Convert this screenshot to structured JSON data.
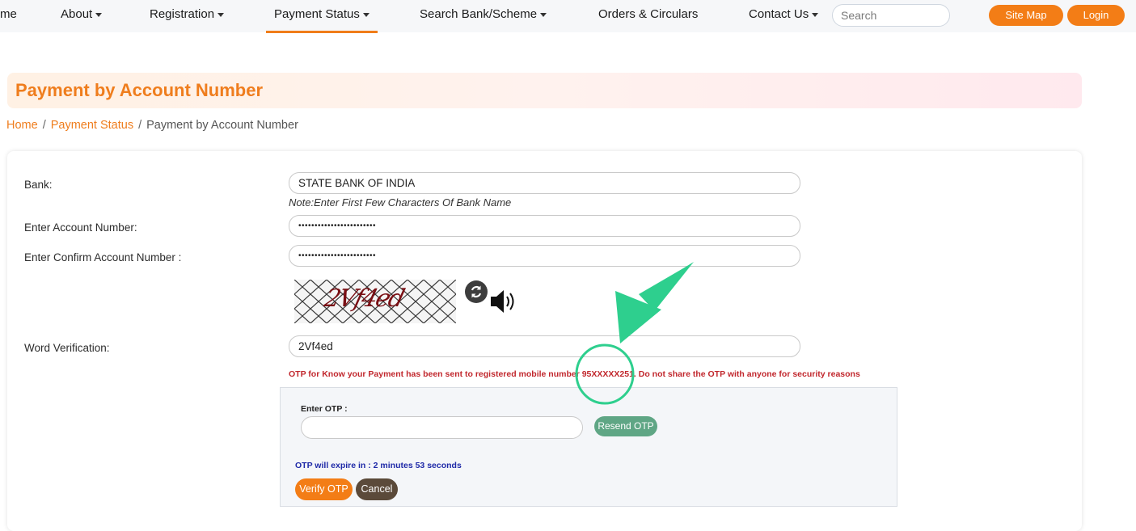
{
  "nav": {
    "items": [
      {
        "label": "me",
        "dropdown": false
      },
      {
        "label": "About",
        "dropdown": true
      },
      {
        "label": "Registration",
        "dropdown": true
      },
      {
        "label": "Payment Status",
        "dropdown": true,
        "active": true
      },
      {
        "label": "Search Bank/Scheme",
        "dropdown": true
      },
      {
        "label": "Orders & Circulars",
        "dropdown": false
      },
      {
        "label": "Contact Us",
        "dropdown": true
      }
    ],
    "search_placeholder": "Search",
    "sitemap_label": "Site Map",
    "login_label": "Login"
  },
  "page": {
    "title": "Payment by Account Number",
    "breadcrumb": [
      "Home",
      "Payment Status",
      "Payment by Account Number"
    ]
  },
  "form": {
    "bank_label": "Bank:",
    "bank_value": "STATE BANK OF INDIA",
    "bank_note": "Note:Enter First Few Characters Of Bank Name",
    "account_label": "Enter Account Number:",
    "account_value": "••••••••••••••••••••••••",
    "confirm_label": "Enter Confirm Account Number :",
    "confirm_value": "••••••••••••••••••••••••",
    "captcha_text": "2Vf4ed",
    "word_label": "Word Verification:",
    "word_value": "2Vf4ed",
    "otp_message": "OTP for Know your Payment has been sent to registered mobile number 95XXXXX251. Do not share the OTP with anyone for security reasons"
  },
  "otp": {
    "label": "Enter OTP :",
    "resend_label": "Resend OTP",
    "expire_text": "OTP will expire in : 2 minutes 53 seconds",
    "verify_label": "Verify OTP",
    "cancel_label": "Cancel"
  },
  "colors": {
    "accent": "#f37d16",
    "resend": "#5fa685",
    "cancel": "#5b4a3a",
    "error": "#c1272d",
    "expire": "#1f2aa8",
    "annotation": "#2ecf8e"
  },
  "icons": {
    "refresh": "refresh-icon",
    "speaker": "speaker-icon",
    "caret": "chevron-down-icon",
    "annotation_arrow": "arrow-icon"
  }
}
